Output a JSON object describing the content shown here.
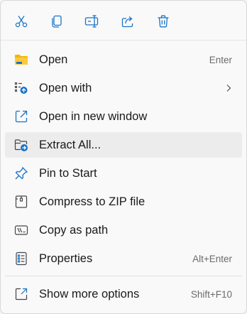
{
  "toolbar": {
    "buttons": [
      {
        "icon": "cut-icon"
      },
      {
        "icon": "copy-icon"
      },
      {
        "icon": "rename-icon"
      },
      {
        "icon": "share-icon"
      },
      {
        "icon": "delete-icon"
      }
    ]
  },
  "items": [
    {
      "label": "Open",
      "shortcut": "Enter",
      "icon": "folder-icon"
    },
    {
      "label": "Open with",
      "shortcut": "",
      "icon": "open-with-icon",
      "has_submenu": true
    },
    {
      "label": "Open in new window",
      "shortcut": "",
      "icon": "new-window-icon"
    },
    {
      "label": "Extract All...",
      "shortcut": "",
      "icon": "extract-folder-icon",
      "hovered": true
    },
    {
      "label": "Pin to Start",
      "shortcut": "",
      "icon": "pin-icon"
    },
    {
      "label": "Compress to ZIP file",
      "shortcut": "",
      "icon": "zip-icon"
    },
    {
      "label": "Copy as path",
      "shortcut": "",
      "icon": "copy-path-icon"
    },
    {
      "label": "Properties",
      "shortcut": "Alt+Enter",
      "icon": "properties-icon"
    },
    {
      "label": "Show more options",
      "shortcut": "Shift+F10",
      "icon": "show-more-icon"
    }
  ],
  "colors": {
    "accent": "#1a73c8",
    "folder_yellow": "#f4b400",
    "hover_bg": "#ececec"
  }
}
